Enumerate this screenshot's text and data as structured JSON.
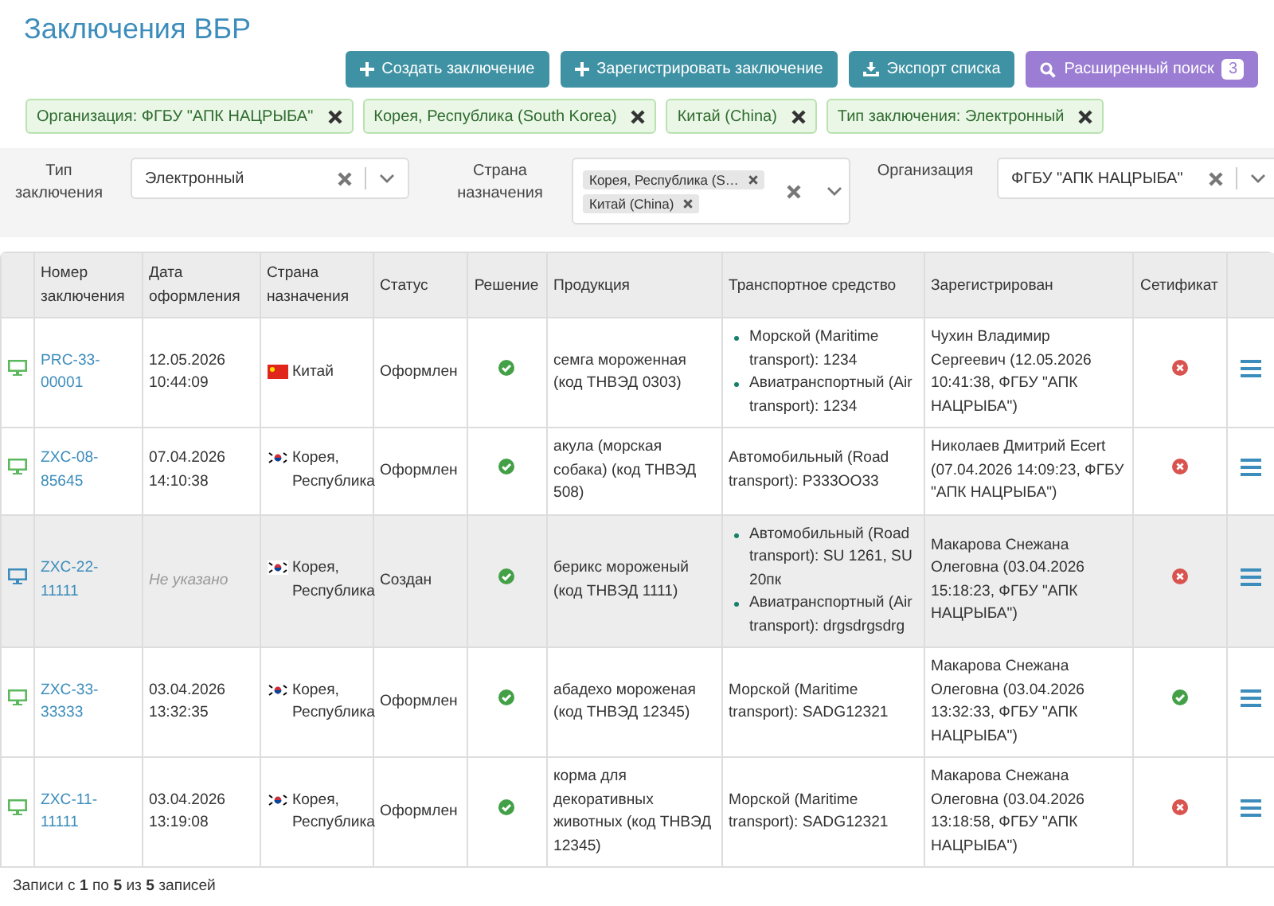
{
  "title": "Заключения ВБР",
  "actions": [
    {
      "kind": "plus",
      "label": "Создать заключение"
    },
    {
      "kind": "plus",
      "label": "Зарегистрировать заключение"
    },
    {
      "kind": "download",
      "label": "Экспорт списка"
    },
    {
      "kind": "search",
      "label": "Расширенный поиск",
      "badge": "3"
    }
  ],
  "active_filters": [
    "Организация: ФГБУ \"АПК НАЦРЫБА\"",
    "Корея, Республика (South Korea)",
    "Китай (China)",
    "Тип заключения: Электронный"
  ],
  "filters": [
    {
      "label": "Тип заключения",
      "value": "Электронный"
    },
    {
      "label": "Страна назначения",
      "chips": [
        "Корея, Республика (S…",
        "Китай (China)"
      ]
    },
    {
      "label": "Организация",
      "value": "ФГБУ \"АПК НАЦРЫБА\""
    }
  ],
  "table": {
    "columns": [
      "Номер заключения",
      "Дата оформления",
      "Страна назначения",
      "Статус",
      "Решение",
      "Продукция",
      "Транспортное средство",
      "Зарегистрирован",
      "Сетификат"
    ],
    "rows": [
      {
        "color": "#5cb85c",
        "highlighted": false,
        "number": "PRC-33-00001",
        "date": "12.05.2026 10:44:09",
        "date_empty": false,
        "country": {
          "kind": "cn",
          "name": "Китай"
        },
        "status": "Оформлен",
        "decision_ok": true,
        "product": "семга мороженная (код ТНВЭД 0303)",
        "transport": [
          "Морской (Maritime transport): 1234",
          "Авиатранспортный (Air transport): 1234"
        ],
        "registered": "Чухин Владимир Сергеевич (12.05.2026 10:41:38, ФГБУ \"АПК НАЦРЫБА\")",
        "certificate_ok": false
      },
      {
        "color": "#5cb85c",
        "highlighted": false,
        "number": "ZXC-08-85645",
        "date": "07.04.2026 14:10:38",
        "date_empty": false,
        "country": {
          "kind": "kr",
          "name": "Корея, Республика"
        },
        "status": "Оформлен",
        "decision_ok": true,
        "product": "акула (морская собака) (код ТНВЭД 508)",
        "transport": [
          "Автомобильный (Road transport): Р333ОО33"
        ],
        "registered": "Николаев Дмитрий Ecert (07.04.2026 14:09:23, ФГБУ \"АПК НАЦРЫБА\")",
        "certificate_ok": false
      },
      {
        "color": "#3c8dbc",
        "highlighted": true,
        "number": "ZXC-22-11111",
        "date": "Не указано",
        "date_empty": true,
        "country": {
          "kind": "kr",
          "name": "Корея, Республика"
        },
        "status": "Создан",
        "decision_ok": true,
        "product": "берикс мороженый (код ТНВЭД 1111)",
        "transport": [
          "Автомобильный (Road transport): SU 1261, SU 20пк",
          "Авиатранспортный (Air transport): drgsdrgsdrg"
        ],
        "registered": "Макарова Снежана Олеговна (03.04.2026 15:18:23, ФГБУ \"АПК НАЦРЫБА\")",
        "certificate_ok": false
      },
      {
        "color": "#5cb85c",
        "highlighted": false,
        "number": "ZXC-33-33333",
        "date": "03.04.2026 13:32:35",
        "date_empty": false,
        "country": {
          "kind": "kr",
          "name": "Корея, Республика"
        },
        "status": "Оформлен",
        "decision_ok": true,
        "product": "абадехо мороженая (код ТНВЭД 12345)",
        "transport": [
          "Морской (Maritime transport): SADG12321"
        ],
        "registered": "Макарова Снежана Олеговна (03.04.2026 13:32:33, ФГБУ \"АПК НАЦРЫБА\")",
        "certificate_ok": true
      },
      {
        "color": "#5cb85c",
        "highlighted": false,
        "number": "ZXC-11-11111",
        "date": "03.04.2026 13:19:08",
        "date_empty": false,
        "country": {
          "kind": "kr",
          "name": "Корея, Республика"
        },
        "status": "Оформлен",
        "decision_ok": true,
        "product": "корма для декоративных животных (код ТНВЭД 12345)",
        "transport": [
          "Морской (Maritime transport): SADG12321"
        ],
        "registered": "Макарова Снежана Олеговна (03.04.2026 13:18:58, ФГБУ \"АПК НАЦРЫБА\")",
        "certificate_ok": false
      }
    ]
  },
  "footer": "Записи с **1** по **5** из **5** записей"
}
